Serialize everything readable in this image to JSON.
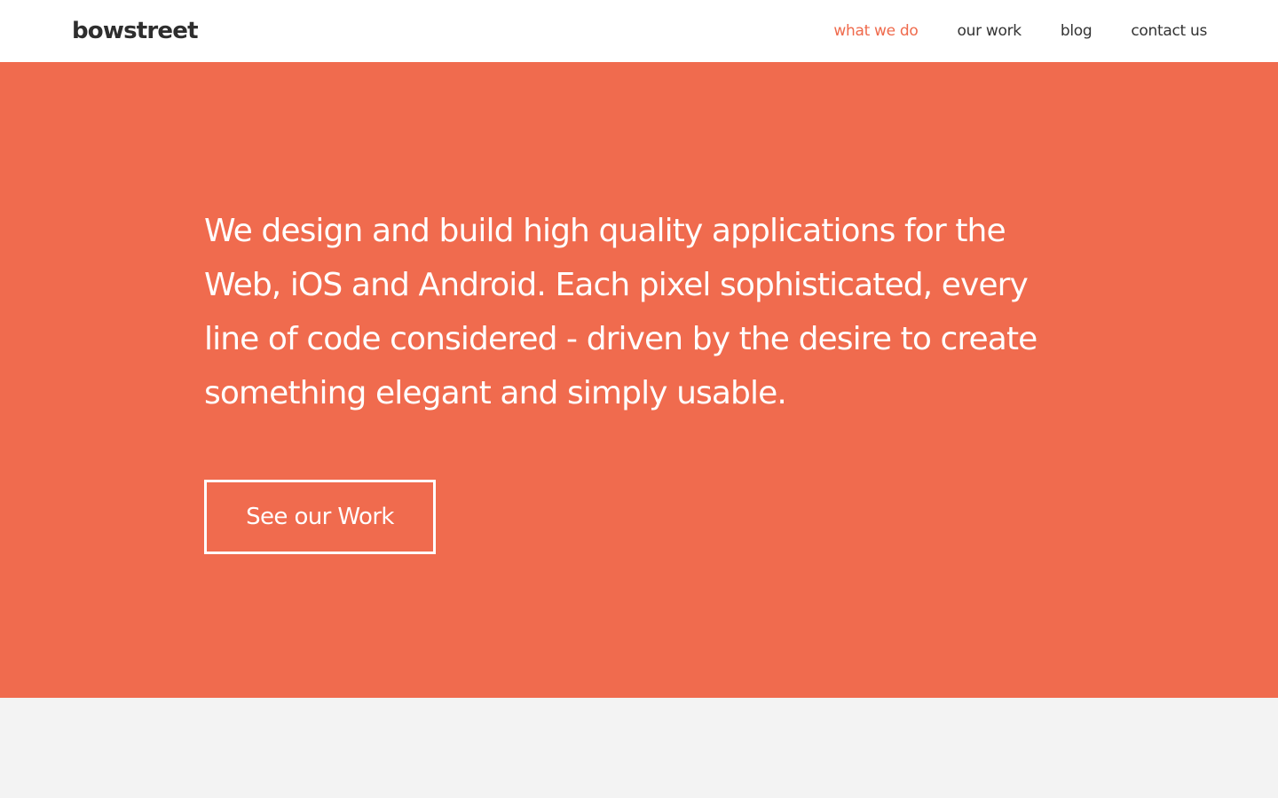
{
  "header": {
    "logo_text": "bowstreet",
    "nav": [
      {
        "label": "what we do",
        "active": true
      },
      {
        "label": "our work",
        "active": false
      },
      {
        "label": "blog",
        "active": false
      },
      {
        "label": "contact us",
        "active": false
      }
    ]
  },
  "hero": {
    "headline": "We design and build high quality applications for the Web, iOS and Android. Each pixel sophisticated, every line of code considered - driven by the desire to create something elegant and simply usable.",
    "cta_label": "See our Work"
  },
  "colors": {
    "accent": "#f06b4e",
    "active_nav": "#ef6a4c",
    "header_bg": "#ffffff",
    "lower_bg": "#f3f3f3",
    "text_dark": "#333333"
  }
}
